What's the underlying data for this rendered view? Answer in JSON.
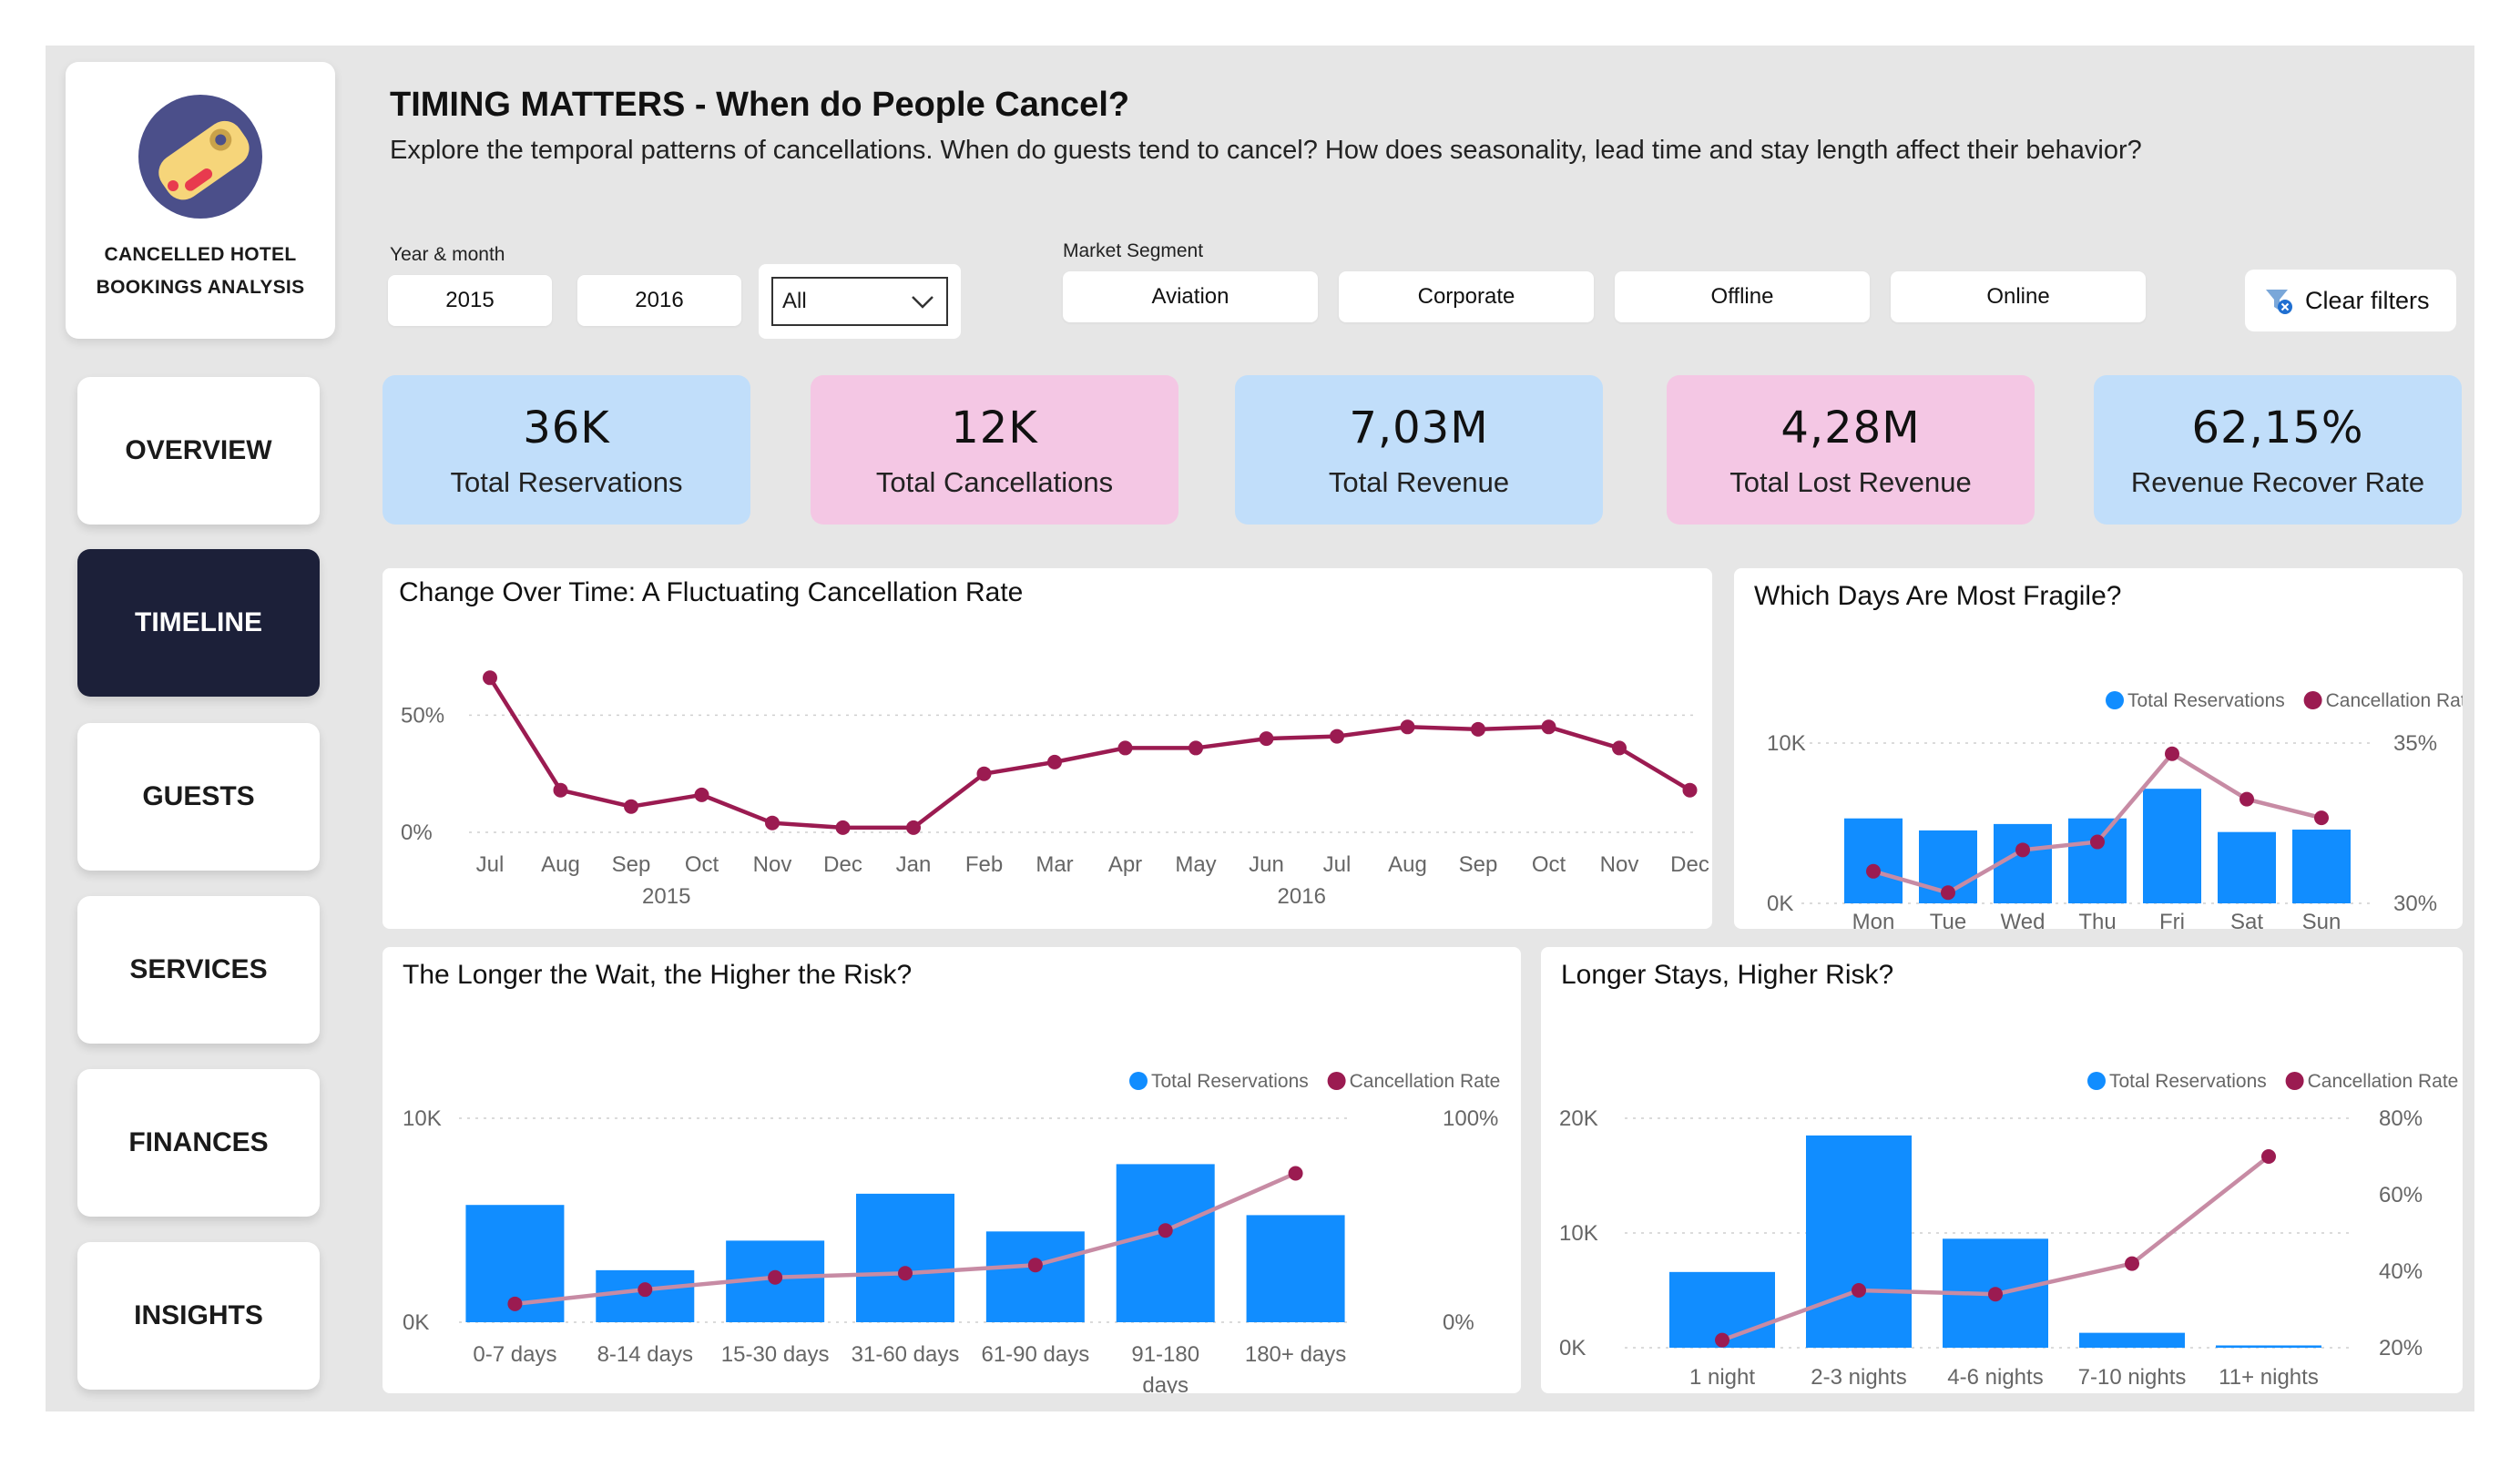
{
  "sidebar": {
    "logo_text_line1": "CANCELLED HOTEL",
    "logo_text_line2": "BOOKINGS ANALYSIS",
    "nav": [
      "OVERVIEW",
      "TIMELINE",
      "GUESTS",
      "SERVICES",
      "FINANCES",
      "INSIGHTS"
    ],
    "active": "TIMELINE"
  },
  "header": {
    "title": "TIMING MATTERS - When do People Cancel?",
    "subtitle": "Explore the temporal patterns of cancellations. When do guests tend to cancel? How does seasonality, lead time and stay length affect their behavior?"
  },
  "filters": {
    "year_label": "Year & month",
    "years": [
      "2015",
      "2016"
    ],
    "dropdown_value": "All",
    "segment_label": "Market Segment",
    "segments": [
      "Aviation",
      "Corporate",
      "Offline",
      "Online"
    ],
    "clear_label": "Clear filters"
  },
  "kpis": [
    {
      "value": "36K",
      "label": "Total Reservations",
      "color": "blue"
    },
    {
      "value": "12K",
      "label": "Total Cancellations",
      "color": "pink"
    },
    {
      "value": "7,03M",
      "label": "Total Revenue",
      "color": "blue"
    },
    {
      "value": "4,28M",
      "label": "Total Lost Revenue",
      "color": "pink"
    },
    {
      "value": "62,15%",
      "label": "Revenue Recover Rate",
      "color": "blue"
    }
  ],
  "colors": {
    "bar": "#118dff",
    "line_dark": "#9b1b51",
    "line_light": "#c78ba4",
    "nav_active": "#1c2039",
    "kpi_blue": "#c1defa",
    "kpi_pink": "#f4c7e4"
  },
  "chart_data": [
    {
      "id": "timeline",
      "type": "line",
      "title": "Change Over Time: A Fluctuating Cancellation Rate",
      "x": [
        "Jul",
        "Aug",
        "Sep",
        "Oct",
        "Nov",
        "Dec",
        "Jan",
        "Feb",
        "Mar",
        "Apr",
        "May",
        "Jun",
        "Jul",
        "Aug",
        "Sep",
        "Oct",
        "Nov",
        "Dec"
      ],
      "year_labels": [
        "2015",
        "2016"
      ],
      "series": [
        {
          "values": [
            66,
            18,
            11,
            16,
            4,
            2,
            2,
            25,
            30,
            36,
            36,
            40,
            41,
            45,
            44,
            45,
            36,
            18
          ]
        }
      ],
      "y_ticks": [
        "0%",
        "50%"
      ],
      "ylim": [
        0,
        70
      ]
    },
    {
      "id": "weekday",
      "type": "bar",
      "title": "Which Days Are Most Fragile?",
      "categories": [
        "Mon",
        "Tue",
        "Wed",
        "Thu",
        "Fri",
        "Sat",
        "Sun"
      ],
      "series": [
        {
          "name": "Total Reservations",
          "values": [
            5300,
            4550,
            4950,
            5300,
            7150,
            4450,
            4600
          ]
        },
        {
          "name": "Cancellation Rate",
          "values": [
            31.2,
            30.4,
            32.0,
            32.3,
            35.6,
            33.9,
            33.2
          ]
        }
      ],
      "y_ticks_left": [
        "0K",
        "10K"
      ],
      "y_ticks_right": [
        "30%",
        "35%"
      ],
      "ylim_left": [
        0,
        10000
      ],
      "ylim_right": [
        30,
        36
      ]
    },
    {
      "id": "leadtime",
      "type": "bar",
      "title": "The Longer the Wait, the Higher the Risk?",
      "categories": [
        "0-7 days",
        "8-14 days",
        "15-30 days",
        "31-60 days",
        "61-90 days",
        "91-180 days",
        "180+ days"
      ],
      "series": [
        {
          "name": "Total Reservations",
          "values": [
            5750,
            2550,
            4000,
            6300,
            4450,
            7750,
            5250
          ]
        },
        {
          "name": "Cancellation Rate",
          "values": [
            9,
            16,
            22,
            24,
            28,
            45,
            73
          ]
        }
      ],
      "y_ticks_left": [
        "0K",
        "10K"
      ],
      "y_ticks_right": [
        "0%",
        "100%"
      ],
      "ylim_left": [
        0,
        10000
      ],
      "ylim_right": [
        0,
        100
      ]
    },
    {
      "id": "stay",
      "type": "bar",
      "title": "Longer Stays, Higher Risk?",
      "categories": [
        "1 night",
        "2-3 nights",
        "4-6 nights",
        "7-10 nights",
        "11+ nights"
      ],
      "series": [
        {
          "name": "Total Reservations",
          "values": [
            6600,
            18500,
            9500,
            1300,
            200
          ]
        },
        {
          "name": "Cancellation Rate",
          "values": [
            22,
            35,
            34,
            42,
            70
          ]
        }
      ],
      "y_ticks_left": [
        "0K",
        "10K",
        "20K"
      ],
      "y_ticks_right": [
        "20%",
        "40%",
        "60%",
        "80%"
      ],
      "ylim_left": [
        0,
        20000
      ],
      "ylim_right": [
        20,
        80
      ]
    }
  ]
}
